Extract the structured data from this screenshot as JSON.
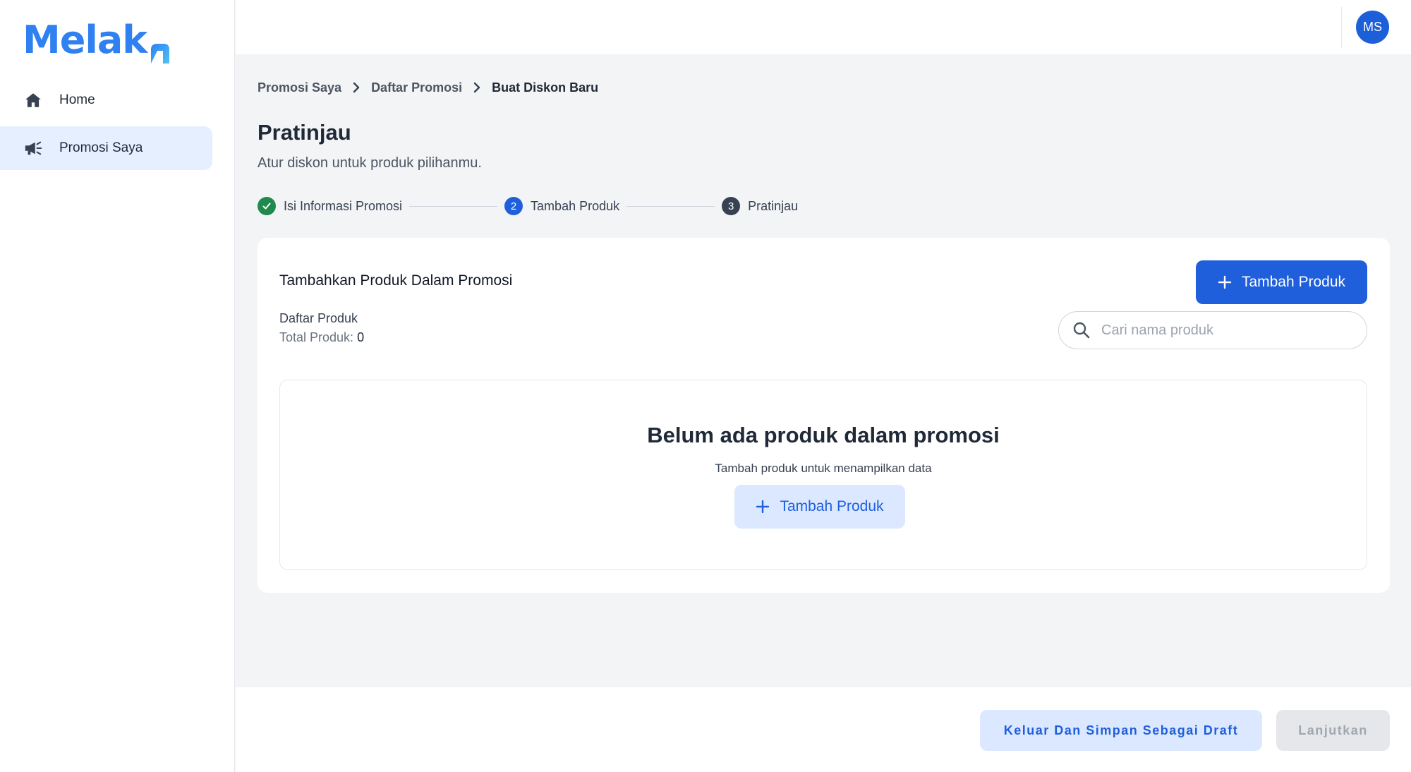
{
  "brand": {
    "logo_text": "Melak",
    "accent": "#2f80f0"
  },
  "sidebar": {
    "items": [
      {
        "label": "Home",
        "icon": "home-icon",
        "active": false
      },
      {
        "label": "Promosi Saya",
        "icon": "megaphone-icon",
        "active": true
      }
    ]
  },
  "topbar": {
    "avatar_initials": "MS"
  },
  "breadcrumb": {
    "items": [
      "Promosi Saya",
      "Daftar Promosi",
      "Buat Diskon Baru"
    ]
  },
  "page": {
    "title": "Pratinjau",
    "subtitle": "Atur diskon untuk produk pilihanmu."
  },
  "stepper": {
    "steps": [
      {
        "number": "",
        "label": "Isi Informasi Promosi",
        "status": "completed",
        "color": "#1f8a4c"
      },
      {
        "number": "2",
        "label": "Tambah Produk",
        "status": "active",
        "color": "#1f5fdc"
      },
      {
        "number": "3",
        "label": "Pratinjau",
        "status": "pending",
        "color": "#374151"
      }
    ]
  },
  "card": {
    "title": "Tambahkan Produk Dalam Promosi",
    "add_button_label": "Tambah Produk",
    "list_title": "Daftar Produk",
    "total_label": "Total Produk: ",
    "total_count": "0",
    "search": {
      "placeholder": "Cari nama produk",
      "value": ""
    },
    "empty": {
      "title": "Belum ada produk dalam promosi",
      "subtitle": "Tambah produk untuk menampilkan data",
      "button_label": "Tambah Produk"
    }
  },
  "footer": {
    "draft_button_label": "Keluar Dan Simpan Sebagai Draft",
    "next_button_label": "Lanjutkan",
    "next_disabled": true
  }
}
